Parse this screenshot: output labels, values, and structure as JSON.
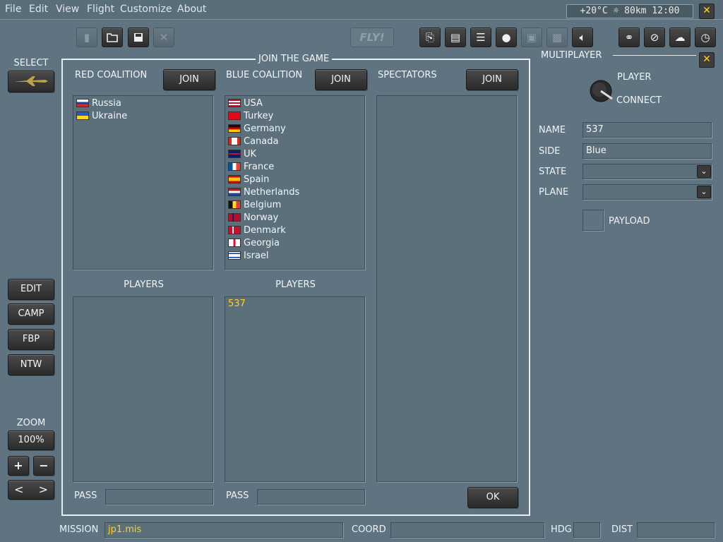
{
  "menu": [
    "File",
    "Edit",
    "View",
    "Flight",
    "Customize",
    "About"
  ],
  "weather": "+20°C ☼ 80km 12:00",
  "close_symbol": "✕",
  "toolbar": {
    "fly_label": "FLY!"
  },
  "left": {
    "select_label": "SELECT",
    "buttons": [
      "EDIT",
      "CAMP",
      "FBP",
      "NTW"
    ],
    "zoom_label": "ZOOM",
    "zoom_value": "100%",
    "plus": "+",
    "minus": "−",
    "left_arrow": "<",
    "right_arrow": ">"
  },
  "dialog": {
    "title": "JOIN THE GAME",
    "red_header": "RED COALITION",
    "blue_header": "BLUE COALITION",
    "spectators_header": "SPECTATORS",
    "join_label": "JOIN",
    "red_countries": [
      "Russia",
      "Ukraine"
    ],
    "blue_countries": [
      "USA",
      "Turkey",
      "Germany",
      "Canada",
      "UK",
      "France",
      "Spain",
      "Netherlands",
      "Belgium",
      "Norway",
      "Denmark",
      "Georgia",
      "Israel"
    ],
    "players_label": "PLAYERS",
    "red_players": [],
    "blue_players": [
      "537"
    ],
    "pass_label": "PASS",
    "ok_label": "OK"
  },
  "multiplayer": {
    "title": "MULTIPLAYER",
    "player_label": "PLAYER",
    "connect_label": "CONNECT",
    "name_label": "NAME",
    "name_value": "537",
    "side_label": "SIDE",
    "side_value": "Blue",
    "state_label": "STATE",
    "state_value": "",
    "plane_label": "PLANE",
    "plane_value": "",
    "payload_label": "PAYLOAD",
    "dropdown_symbol": "⌄"
  },
  "status": {
    "mission_label": "MISSION",
    "mission_value": "jp1.mis",
    "coord_label": "COORD",
    "coord_value": "",
    "hdg_label": "HDG",
    "hdg_value": "",
    "dist_label": "DIST",
    "dist_value": ""
  },
  "colors": {
    "background": "#5f7480",
    "accent_yellow": "#ffd21e",
    "button_dark": "#2c2c2c"
  }
}
